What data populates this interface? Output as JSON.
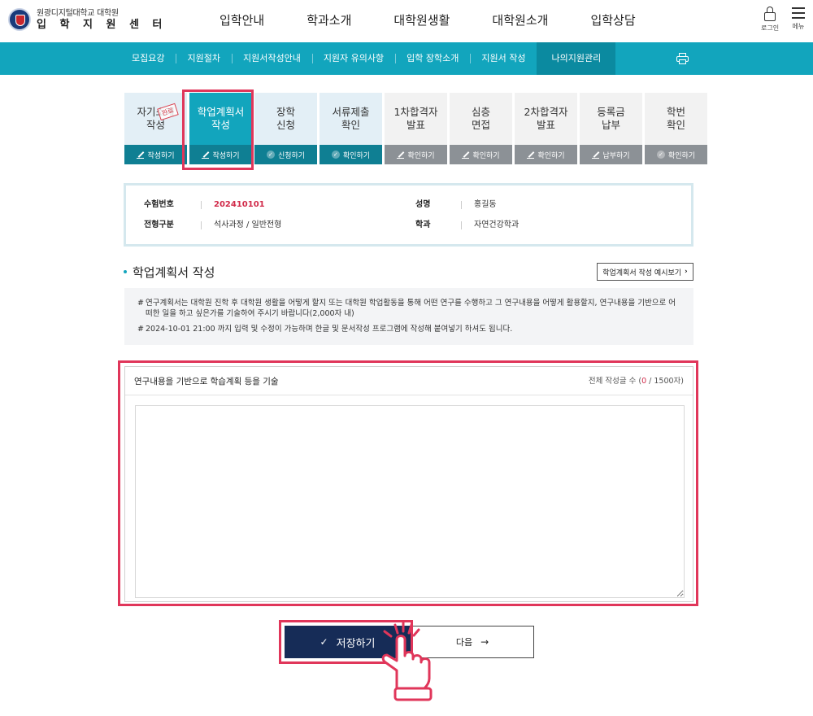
{
  "header": {
    "logo_line1": "원광디지털대학교 대학원",
    "logo_line2": "입 학 지 원 센 터",
    "nav": [
      "입학안내",
      "학과소개",
      "대학원생활",
      "대학원소개",
      "입학상담"
    ],
    "login_label": "로그인",
    "menu_label": "메뉴"
  },
  "subnav": {
    "items": [
      "모집요강",
      "지원절차",
      "지원서작성안내",
      "지원자 유의사항",
      "입학 장학소개",
      "지원서 작성",
      "나의지원관리"
    ],
    "active_index": 6
  },
  "steps": [
    {
      "title": "자기소개\n작성",
      "action": "작성하기",
      "state": "done",
      "icon": "pencil-icon",
      "stamp": "완료"
    },
    {
      "title": "학업계획서\n작성",
      "action": "작성하기",
      "state": "current",
      "icon": "pencil-icon"
    },
    {
      "title": "장학\n신청",
      "action": "신청하기",
      "state": "done",
      "icon": "check-icon"
    },
    {
      "title": "서류제출\n확인",
      "action": "확인하기",
      "state": "done",
      "icon": "check-icon"
    },
    {
      "title": "1차합격자\n발표",
      "action": "확인하기",
      "state": "pending",
      "icon": "pencil-icon"
    },
    {
      "title": "심층\n면접",
      "action": "확인하기",
      "state": "pending",
      "icon": "pencil-icon"
    },
    {
      "title": "2차합격자\n발표",
      "action": "확인하기",
      "state": "pending",
      "icon": "pencil-icon"
    },
    {
      "title": "등록금\n납부",
      "action": "납부하기",
      "state": "pending",
      "icon": "pencil-icon"
    },
    {
      "title": "학번\n확인",
      "action": "확인하기",
      "state": "pending",
      "icon": "check-icon"
    }
  ],
  "applicant": {
    "exam_no_label": "수험번호",
    "exam_no": "202410101",
    "name_label": "성명",
    "name": "홍길동",
    "type_label": "전형구분",
    "type": "석사과정 / 일반전형",
    "dept_label": "학과",
    "dept": "자연건강학과"
  },
  "section": {
    "title": "학업계획서 작성",
    "example_button": "학업계획서 작성 예시보기",
    "notice_lines": [
      "연구계획서는 대학원 진학 후 대학원 생활을 어떻게 할지 또는 대학원 학업활동을 통해 어떤 연구를 수행하고 그 연구내용을 어떻게 활용할지, 연구내용을 기반으로 어떠한 일을 하고 싶은가를 기술하여 주시기 바랍니다(2,000자 내)",
      "2024-10-01 21:00 까지 입력 및 수정이 가능하며 한글 및 문서작성 프로그램에 작성해 붙여넣기 하셔도 됩니다."
    ]
  },
  "editor": {
    "label": "연구내용을 기반으로 학습계획 등을 기술",
    "count_prefix": "전체 작성글 수 (",
    "count_current": "0",
    "count_suffix": " / 1500자)",
    "value": ""
  },
  "actions": {
    "save": "저장하기",
    "next": "다음"
  },
  "colors": {
    "accent": "#12a5bd",
    "step_bar": "#0f7f93",
    "pending_bar": "#8c9196",
    "highlight": "#e0365a",
    "save_button": "#162c57",
    "exam_no": "#d12b4a"
  }
}
